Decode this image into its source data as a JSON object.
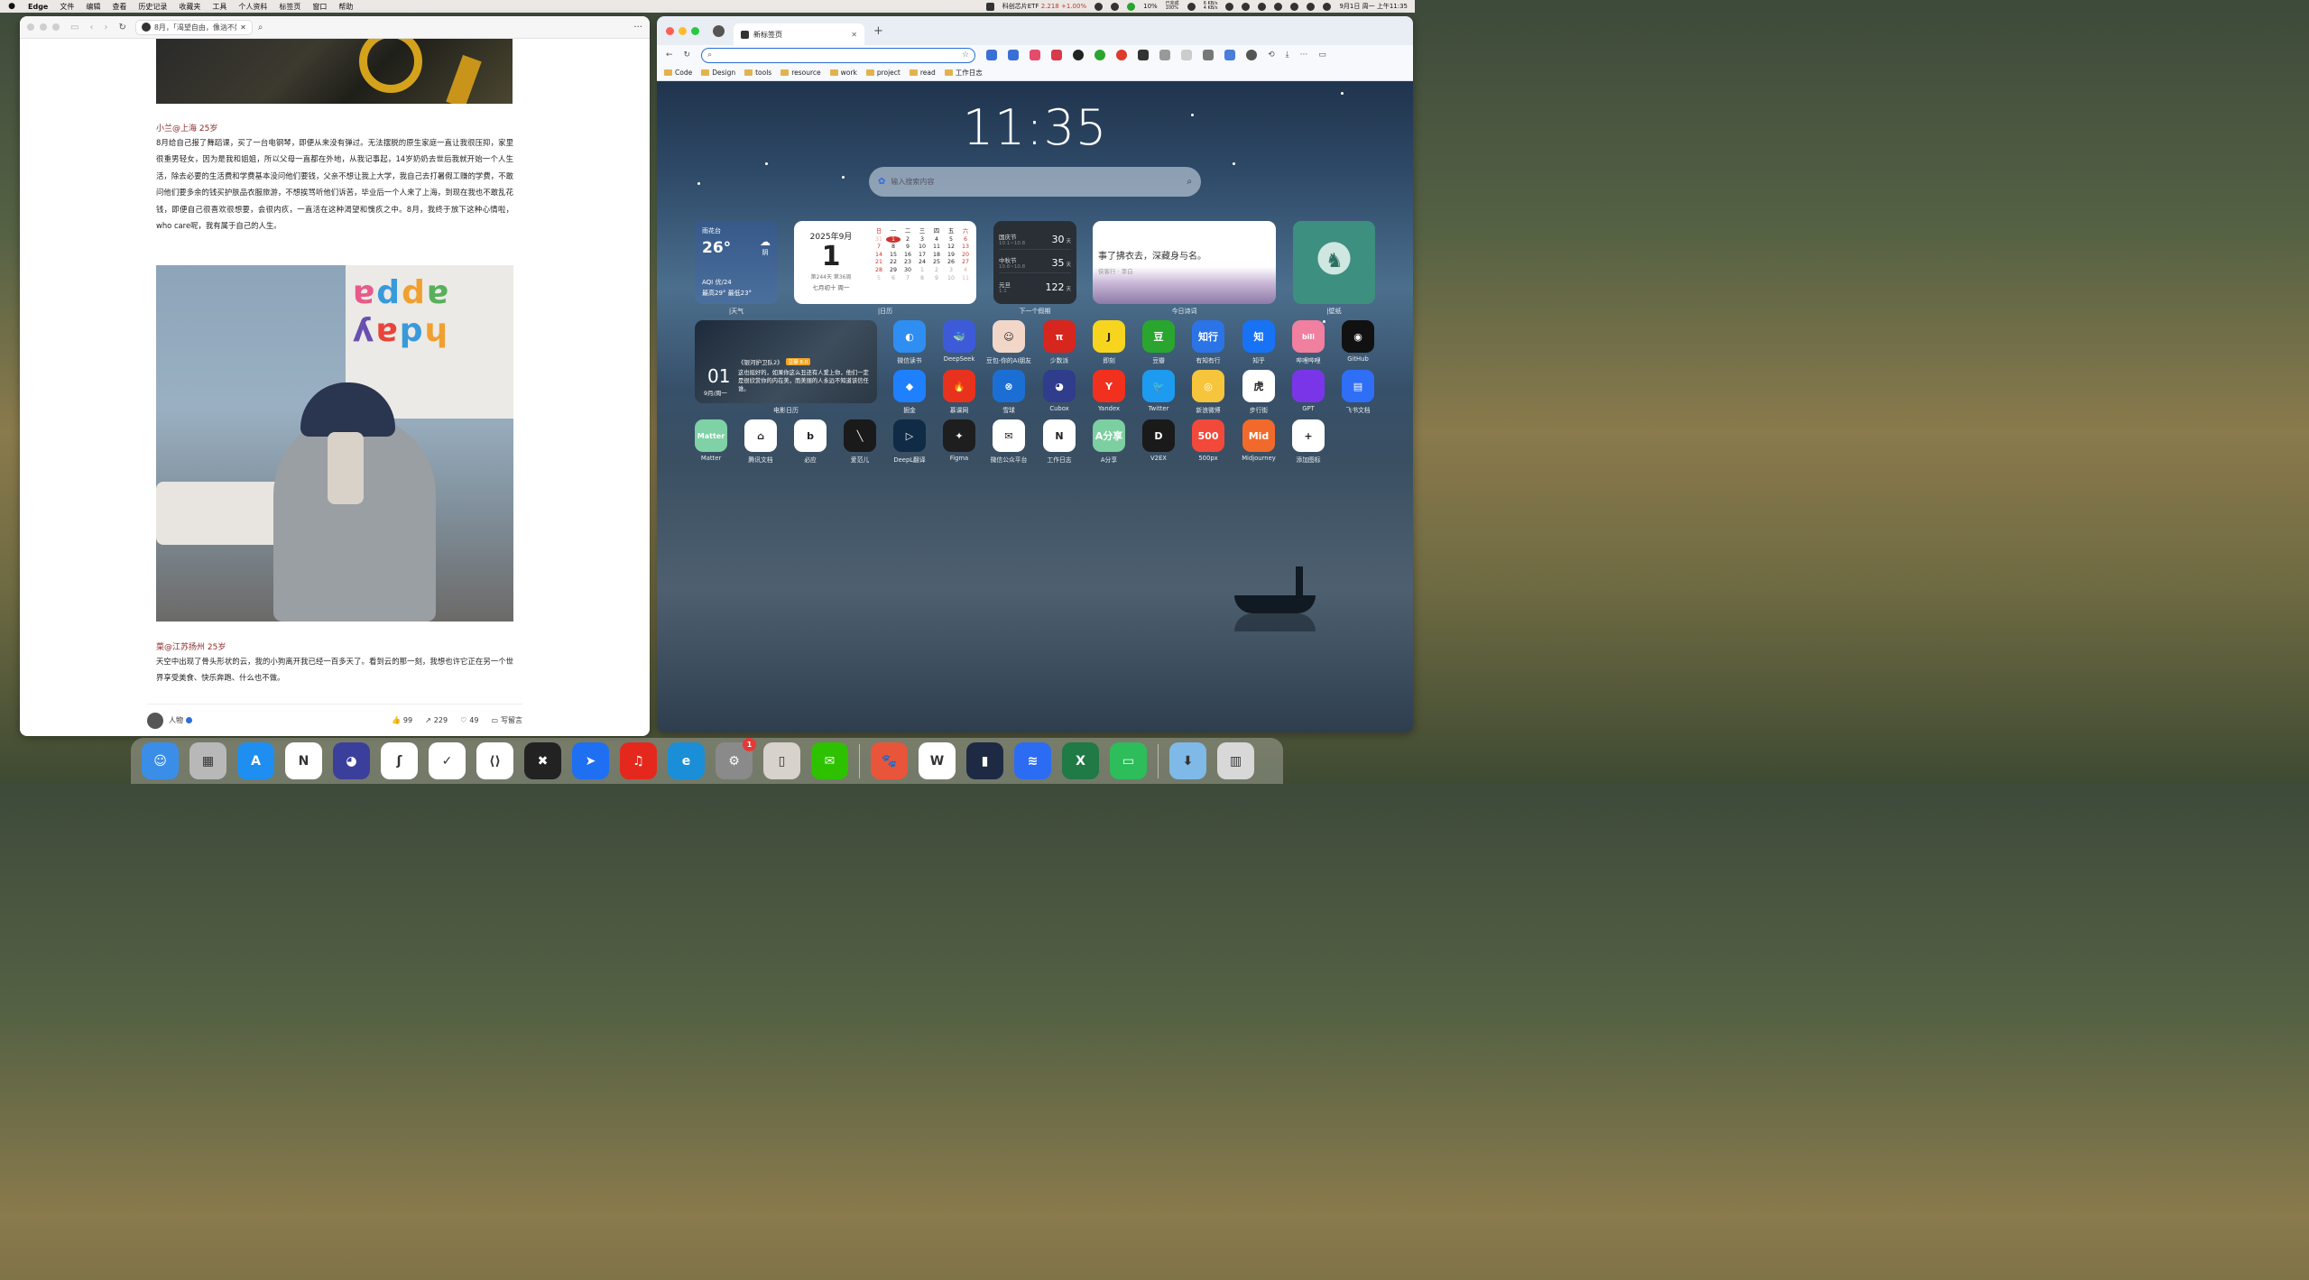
{
  "menubar": {
    "app": "Edge",
    "items": [
      "文件",
      "编辑",
      "查看",
      "历史记录",
      "收藏夹",
      "工具",
      "个人资料",
      "标签页",
      "窗口",
      "帮助"
    ],
    "stock_name": "科创芯片ETF",
    "stock_value": "2.218",
    "stock_change": "+1.00%",
    "battery": "10%",
    "net_up": "6 KB/s",
    "net_down": "4 KB/s",
    "clock": "9月1日 周一 上午11:35",
    "proxy": "已完成",
    "proxy2": "100%"
  },
  "left": {
    "tab_title": "8月，「渴望自由，像汹不好好",
    "blocks": [
      {
        "author": "小兰@上海 25岁",
        "text": "8月给自己报了舞蹈课，买了一台电钢琴，即便从来没有弹过。无法摆脱的原生家庭一直让我很压抑，家里很重男轻女，因为是我和姐姐，所以父母一直都在外地，从我记事起，14岁奶奶去世后我就开始一个人生活，除去必要的生活费和学费基本没问他们要钱，父亲不想让我上大学，我自己去打暑假工赚的学费，不敢问他们要多余的钱买护肤品衣服旅游，不想挨骂听他们诉苦，毕业后一个人来了上海，到现在我也不敢乱花钱，即便自己很喜欢很想要，会很内疚，一直活在这种渴望和愧疚之中。8月，我终于放下这种心情啦，who care呢，我有属于自己的人生。"
      },
      {
        "author": "菜@江苏扬州 25岁",
        "text": "天空中出现了骨头形状的云，我的小狗离开我已经一百多天了。看到云的那一刻，我想也许它正在另一个世界享受美食、快乐奔跑、什么也不做。"
      }
    ],
    "photo_letters": "ɐddɐɥ\nʎɐpɥ",
    "footer": {
      "user": "人物",
      "likes": "99",
      "shares": "229",
      "favs": "49",
      "comment": "写留言"
    }
  },
  "right": {
    "tab_title": "新标签页",
    "bookmarks": [
      "Code",
      "Design",
      "tools",
      "resource",
      "work",
      "project",
      "read",
      "工作日志"
    ],
    "time": "11:35",
    "search_placeholder": "输入搜索内容",
    "weather": {
      "location": "雨花台",
      "temp": "26°",
      "cond": "阴",
      "aqi": "AQI 优/24",
      "range": "最高29° 最低23°",
      "label": "|天气"
    },
    "calendar": {
      "month": "2025年9月",
      "day": "1",
      "week": "第244天 第36周",
      "lunar": "七月初十 周一",
      "label": "|日历",
      "head": [
        "日",
        "一",
        "二",
        "三",
        "四",
        "五",
        "六"
      ],
      "days": [
        "31",
        "1",
        "2",
        "3",
        "4",
        "5",
        "6",
        "7",
        "8",
        "9",
        "10",
        "11",
        "12",
        "13",
        "14",
        "15",
        "16",
        "17",
        "18",
        "19",
        "20",
        "21",
        "22",
        "23",
        "24",
        "25",
        "26",
        "27",
        "28",
        "29",
        "30",
        "1",
        "2",
        "3",
        "4",
        "5",
        "6",
        "7",
        "8",
        "9",
        "10",
        "11"
      ]
    },
    "holidays": {
      "label": "下一个假期",
      "items": [
        {
          "name": "国庆节",
          "date": "10.1~10.8",
          "days": "30"
        },
        {
          "name": "中秋节",
          "date": "10.6~10.8",
          "days": "35"
        },
        {
          "name": "元旦",
          "date": "1.1",
          "days": "122"
        }
      ],
      "unit": "天"
    },
    "poem": {
      "text": "事了拂衣去，深藏身与名。",
      "source": "侠客行 · 李白",
      "label": "今日诗词"
    },
    "wallpaper_label": "|壁纸",
    "movie": {
      "date": "01",
      "weekday": "9月/周一",
      "title": "《银河护卫队2》",
      "score": "豆瓣 8.0",
      "quote": "这也挺好的，如果你这么丑还有人爱上你，他们一定是很欣赏你的内在美，而美丽的人永远不知道该信任谁。",
      "label": "电影日历"
    },
    "apps": [
      {
        "name": "微信读书",
        "color": "#2f8ef2",
        "glyph": "◐"
      },
      {
        "name": "DeepSeek",
        "color": "#3d5bd9",
        "glyph": "🐳"
      },
      {
        "name": "豆包-你的AI朋友",
        "color": "#f2d7c8",
        "glyph": "☺"
      },
      {
        "name": "少数派",
        "color": "#d7261e",
        "glyph": "π"
      },
      {
        "name": "即刻",
        "color": "#f7d51f",
        "glyph": "J"
      },
      {
        "name": "豆瓣",
        "color": "#2aa52e",
        "glyph": "豆"
      },
      {
        "name": "有知有行",
        "color": "#2b74e8",
        "glyph": "知行"
      },
      {
        "name": "知乎",
        "color": "#1772f6",
        "glyph": "知"
      },
      {
        "name": "哔哩哔哩",
        "color": "#f07fa0",
        "glyph": "bili"
      },
      {
        "name": "GitHub",
        "color": "#111111",
        "glyph": "◉"
      },
      {
        "name": "掘金",
        "color": "#1e80ff",
        "glyph": "◆"
      },
      {
        "name": "慕课网",
        "color": "#e8321d",
        "glyph": "🔥"
      },
      {
        "name": "雪球",
        "color": "#1b6fd4",
        "glyph": "⊗"
      },
      {
        "name": "Cubox",
        "color": "#2f3d8c",
        "glyph": "◕"
      },
      {
        "name": "Yandex",
        "color": "#f2301e",
        "glyph": "Y"
      },
      {
        "name": "Twitter",
        "color": "#1d9bf0",
        "glyph": "🐦"
      },
      {
        "name": "新浪微博",
        "color": "#f7c53b",
        "glyph": "◎"
      },
      {
        "name": "步行街",
        "color": "#ffffff",
        "glyph": "虎"
      },
      {
        "name": "GPT",
        "color": "#7b35e8",
        "glyph": ""
      },
      {
        "name": "飞书文档",
        "color": "#2f6ef6",
        "glyph": "▤"
      },
      {
        "name": "Matter",
        "color": "#7fd1a6",
        "glyph": "Matter"
      },
      {
        "name": "腾讯文档",
        "color": "#ffffff",
        "glyph": "⌂"
      },
      {
        "name": "必应",
        "color": "#ffffff",
        "glyph": "b"
      },
      {
        "name": "爱范儿",
        "color": "#1a1a1a",
        "glyph": "╲"
      },
      {
        "name": "DeepL翻译",
        "color": "#0f2b46",
        "glyph": "▷"
      },
      {
        "name": "Figma",
        "color": "#1e1e1e",
        "glyph": "✦"
      },
      {
        "name": "微信公众平台",
        "color": "#ffffff",
        "glyph": "✉"
      },
      {
        "name": "工作日志",
        "color": "#ffffff",
        "glyph": "N"
      },
      {
        "name": "A分享",
        "color": "#7ccfa0",
        "glyph": "A分享"
      },
      {
        "name": "V2EX",
        "color": "#1a1a1a",
        "glyph": "D"
      },
      {
        "name": "500px",
        "color": "#f2493a",
        "glyph": "500"
      },
      {
        "name": "Midjourney",
        "color": "#f26a2b",
        "glyph": "Mid"
      },
      {
        "name": "添加图标",
        "color": "#ffffff",
        "glyph": "+"
      }
    ]
  },
  "dock": [
    {
      "name": "Finder",
      "color": "#3a8ee8",
      "glyph": "☺"
    },
    {
      "name": "Launchpad",
      "color": "#b8b8b8",
      "glyph": "▦"
    },
    {
      "name": "App Store",
      "color": "#1f8ef1",
      "glyph": "A"
    },
    {
      "name": "Notion",
      "color": "#ffffff",
      "glyph": "N"
    },
    {
      "name": "Cubox",
      "color": "#3b3f9c",
      "glyph": "◕"
    },
    {
      "name": "Cursor",
      "color": "#ffffff",
      "glyph": "ʃ"
    },
    {
      "name": "Todo",
      "color": "#ffffff",
      "glyph": "✓"
    },
    {
      "name": "VS Code",
      "color": "#ffffff",
      "glyph": "⟨⟩"
    },
    {
      "name": "Xcode",
      "color": "#222222",
      "glyph": "✖"
    },
    {
      "name": "Lark",
      "color": "#1e6ff2",
      "glyph": "➤"
    },
    {
      "name": "Music",
      "color": "#e5281e",
      "glyph": "♫"
    },
    {
      "name": "Edge",
      "color": "#1a8fd8",
      "glyph": "e"
    },
    {
      "name": "Settings",
      "color": "#8a8a8a",
      "glyph": "⚙",
      "badge": "1"
    },
    {
      "name": "iPhone Mirroring",
      "color": "#d7d2cb",
      "glyph": "▯"
    },
    {
      "name": "WeChat",
      "color": "#2dc100",
      "glyph": "✉"
    },
    {
      "name": "Legacy",
      "color": "#e8553a",
      "glyph": "🐾"
    },
    {
      "name": "WPS",
      "color": "#ffffff",
      "glyph": "W"
    },
    {
      "name": "Voice",
      "color": "#1e2a44",
      "glyph": "▮"
    },
    {
      "name": "Arc",
      "color": "#2b6cf2",
      "glyph": "≋"
    },
    {
      "name": "Excel",
      "color": "#1f7a45",
      "glyph": "X"
    },
    {
      "name": "Messages",
      "color": "#2dbd5b",
      "glyph": "▭"
    },
    {
      "name": "Downloads",
      "color": "#7fb9e8",
      "glyph": "⬇"
    },
    {
      "name": "Trash",
      "color": "#d8d8d8",
      "glyph": "▥"
    }
  ]
}
